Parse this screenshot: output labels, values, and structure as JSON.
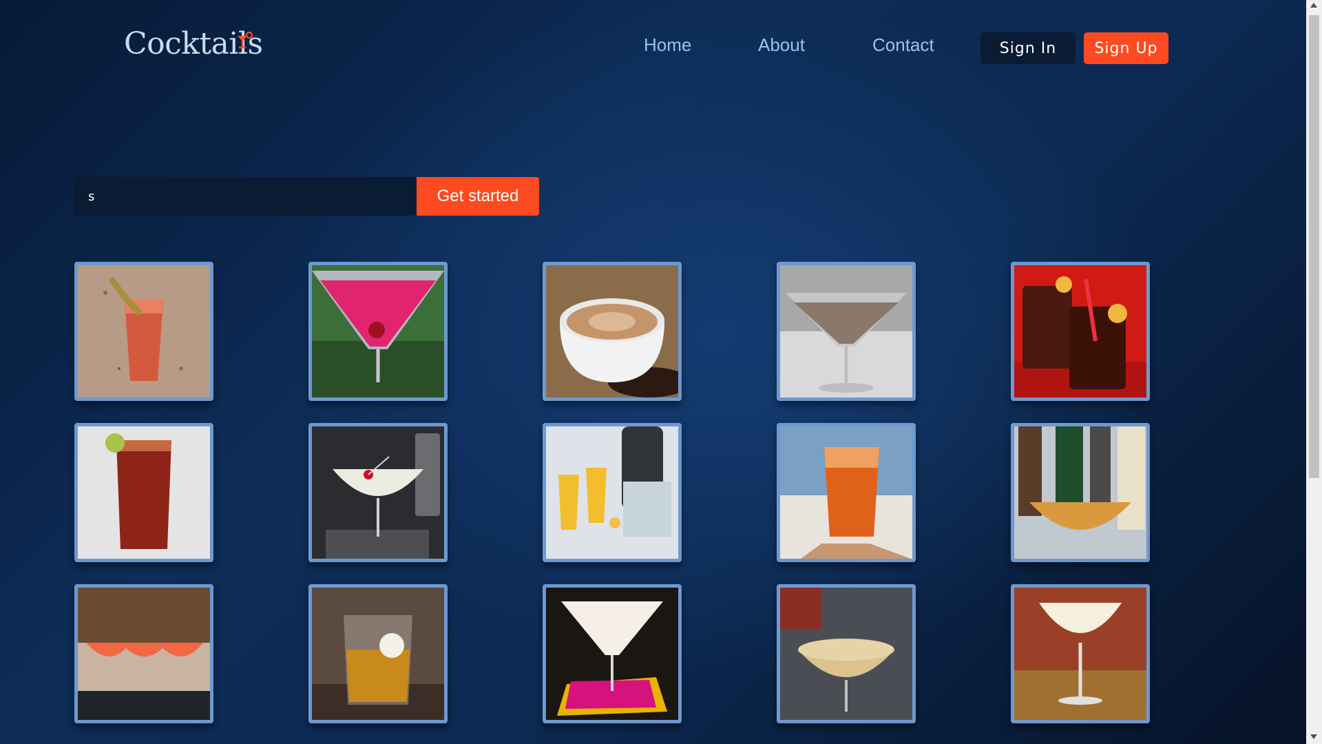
{
  "brand": {
    "name": "Cocktails",
    "icon": "cocktail-glass-icon"
  },
  "nav": {
    "links": [
      "Home",
      "About",
      "Contact"
    ],
    "sign_in": "Sign In",
    "sign_up": "Sign Up"
  },
  "search": {
    "value": "s",
    "button": "Get started"
  },
  "drinks": [
    "bloody-mary-glass",
    "pink-martini-cherry",
    "cappuccino-cup",
    "chocolate-martini",
    "red-tea-mugs",
    "red-beer-highball",
    "white-coupe-cherry",
    "mimosa-flutes",
    "orange-spritz",
    "amber-coupe-bottles",
    "pink-frozen-margaritas",
    "whisky-rocks-glass",
    "white-martini-pink-napkin",
    "yellow-sour-coupe",
    "white-foam-coupe"
  ],
  "colors": {
    "accent": "#fd4a20",
    "card_border": "#6d99d0",
    "nav_text": "#9cc2ef",
    "logo_text": "#c8dbf0"
  }
}
